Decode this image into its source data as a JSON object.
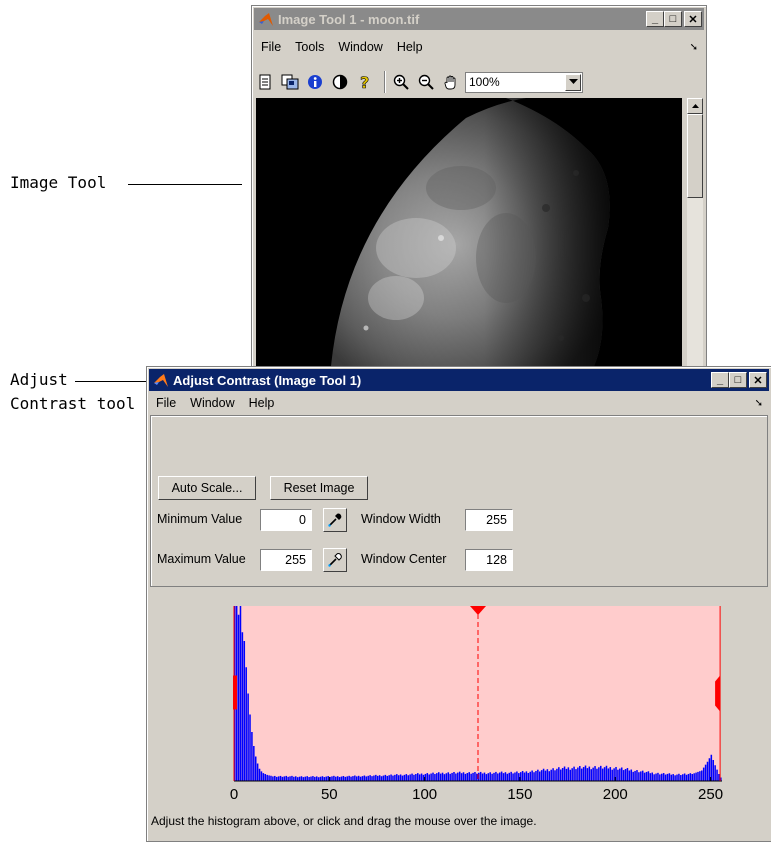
{
  "callouts": {
    "image_tool": "Image Tool",
    "adjust_contrast_line1": "Adjust",
    "adjust_contrast_line2": "Contrast tool"
  },
  "image_tool_window": {
    "title": "Image Tool 1 - moon.tif",
    "menu": [
      "File",
      "Tools",
      "Window",
      "Help"
    ],
    "toolbar_icons": [
      "new-figure-icon",
      "overview-icon",
      "pixel-info-icon",
      "contrast-icon",
      "help-icon",
      "zoom-in-icon",
      "zoom-out-icon",
      "pan-hand-icon"
    ],
    "zoom_value": "100%"
  },
  "adjust_contrast_window": {
    "title": "Adjust Contrast (Image Tool 1)",
    "menu": [
      "File",
      "Window",
      "Help"
    ],
    "buttons": {
      "auto_scale": "Auto Scale...",
      "reset_image": "Reset Image"
    },
    "fields": {
      "minimum_label": "Minimum Value",
      "minimum_value": "0",
      "maximum_label": "Maximum Value",
      "maximum_value": "255",
      "width_label": "Window Width",
      "width_value": "255",
      "center_label": "Window Center",
      "center_value": "128"
    },
    "status": "Adjust the histogram above, or click and drag the mouse over the image.",
    "colors": {
      "window_fill": "#ffcccc",
      "bars": "#0000ff",
      "markers": "#ff0000"
    }
  },
  "chart_data": {
    "type": "bar",
    "xlim": [
      0,
      256
    ],
    "x_ticks": [
      0,
      50,
      100,
      150,
      200,
      250
    ],
    "window_min": 0,
    "window_max": 255,
    "window_center": 128,
    "bins": [
      [
        0,
        1.0
      ],
      [
        1,
        1.0
      ],
      [
        2,
        0.95
      ],
      [
        3,
        1.0
      ],
      [
        4,
        0.85
      ],
      [
        5,
        0.8
      ],
      [
        6,
        0.65
      ],
      [
        7,
        0.5
      ],
      [
        8,
        0.38
      ],
      [
        9,
        0.28
      ],
      [
        10,
        0.2
      ],
      [
        11,
        0.14
      ],
      [
        12,
        0.1
      ],
      [
        13,
        0.07
      ],
      [
        14,
        0.055
      ],
      [
        15,
        0.045
      ],
      [
        16,
        0.04
      ],
      [
        17,
        0.035
      ],
      [
        18,
        0.032
      ],
      [
        19,
        0.03
      ],
      [
        20,
        0.028
      ],
      [
        30,
        0.026
      ],
      [
        40,
        0.025
      ],
      [
        50,
        0.026
      ],
      [
        60,
        0.027
      ],
      [
        70,
        0.03
      ],
      [
        80,
        0.033
      ],
      [
        90,
        0.037
      ],
      [
        100,
        0.042
      ],
      [
        110,
        0.046
      ],
      [
        120,
        0.048
      ],
      [
        130,
        0.046
      ],
      [
        140,
        0.048
      ],
      [
        150,
        0.05
      ],
      [
        160,
        0.06
      ],
      [
        170,
        0.072
      ],
      [
        180,
        0.078
      ],
      [
        190,
        0.08
      ],
      [
        200,
        0.075
      ],
      [
        210,
        0.06
      ],
      [
        220,
        0.045
      ],
      [
        230,
        0.038
      ],
      [
        240,
        0.04
      ],
      [
        245,
        0.06
      ],
      [
        248,
        0.11
      ],
      [
        250,
        0.15
      ],
      [
        252,
        0.09
      ],
      [
        254,
        0.04
      ],
      [
        255,
        0.02
      ]
    ]
  }
}
